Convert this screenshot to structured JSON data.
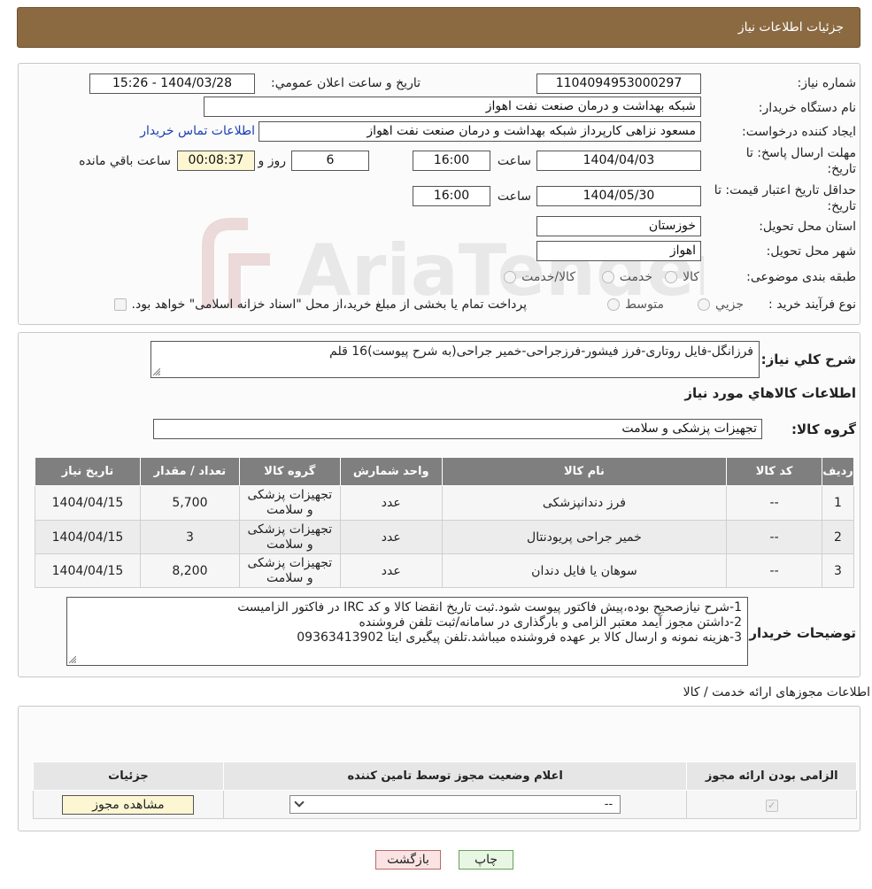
{
  "header": {
    "title": "جزئیات اطلاعات نیاز"
  },
  "watermark": {
    "text": "AriaTender.neT"
  },
  "details": {
    "need_number_label": "شماره نیاز:",
    "need_number": "1104094953000297",
    "announce_label": "تاریخ و ساعت اعلان عمومي:",
    "announce_value": "1404/03/28 - 15:26",
    "buyer_label": "نام دستگاه خريدار:",
    "buyer_value": "شبکه بهداشت و درمان صنعت نفت اهواز",
    "creator_label": "ايجاد کننده درخواست:",
    "creator_value": "مسعود نزاهی کارپرداز شبکه بهداشت و درمان صنعت نفت اهواز",
    "contact_link": "اطلاعات تماس خریدار",
    "deadline_label_1": "مهلت ارسال پاسخ: تا",
    "deadline_label_2": "تاريخ:",
    "deadline_date": "1404/04/03",
    "time_label": "ساعت",
    "deadline_time": "16:00",
    "days_value": "6",
    "days_label": "روز و",
    "remaining_time": "00:08:37",
    "remaining_label": "ساعت باقي مانده",
    "validity_label_1": "حداقل تاريخ اعتبار قيمت: تا",
    "validity_label_2": "تاريخ:",
    "validity_date": "1404/05/30",
    "validity_time": "16:00",
    "province_label": "استان محل تحويل:",
    "province_value": "خوزستان",
    "city_label": "شهر محل تحويل:",
    "city_value": "اهواز",
    "category_label": "طبقه بندی موضوعی:",
    "category_options": [
      "کالا",
      "خدمت",
      "کالا/خدمت"
    ],
    "purchase_type_label": "نوع فرآيند خريد :",
    "purchase_options": [
      "جزيي",
      "متوسط"
    ],
    "purchase_note": "پرداخت تمام يا بخشی از مبلغ خريد،از محل \"اسناد خزانه اسلامی\" خواهد بود."
  },
  "summary": {
    "label": "شرح کلي نياز:",
    "value": "فرزانگل-فایل روتاری-فرز فیشور-فرزجراحی-خمیر جراحی(به شرح پیوست)16 قلم",
    "goods_info_title": "اطلاعات کالاهاي مورد نياز",
    "group_label": "گروه کالا:",
    "group_value": "تجهيزات پزشکی و سلامت"
  },
  "goods_table": {
    "headers": [
      "رديف",
      "کد کالا",
      "نام کالا",
      "واحد شمارش",
      "گروه کالا",
      "تعداد / مقدار",
      "تاریخ نیاز"
    ],
    "rows": [
      {
        "row": "1",
        "code": "--",
        "name": "فرز دندانپزشکی",
        "unit": "عدد",
        "group": "تجهيزات پزشکی و سلامت",
        "qty": "5,700",
        "date": "1404/04/15"
      },
      {
        "row": "2",
        "code": "--",
        "name": "خمیر جراحی پریودنتال",
        "unit": "عدد",
        "group": "تجهيزات پزشکی و سلامت",
        "qty": "3",
        "date": "1404/04/15"
      },
      {
        "row": "3",
        "code": "--",
        "name": "سوهان یا فایل دندان",
        "unit": "عدد",
        "group": "تجهيزات پزشکی و سلامت",
        "qty": "8,200",
        "date": "1404/04/15"
      }
    ]
  },
  "buyer_notes": {
    "label": "توضيحات خريدار:",
    "lines": [
      "1-شرح نیازصحیح بوده،پیش فاکتور پیوست شود.ثبت تاریخ انقضا کالا و کد IRC در فاکتور الزامیست",
      "2-داشتن مجوز آیمد معتبر الزامی و بارگذاری در سامانه/ثبت تلفن فروشنده",
      "3-هزینه نمونه و ارسال کالا بر عهده فروشنده میباشد.تلفن پیگیری ایتا 09363413902"
    ]
  },
  "permits": {
    "title": "اطلاعات مجوزهای ارائه خدمت / کالا",
    "headers": [
      "الزامی بودن ارائه مجوز",
      "اعلام وضعیت مجوز توسط تامین کننده",
      "جزئیات"
    ],
    "select_value": "--",
    "view_button": "مشاهده مجوز"
  },
  "actions": {
    "print": "چاپ",
    "back": "بازگشت"
  }
}
